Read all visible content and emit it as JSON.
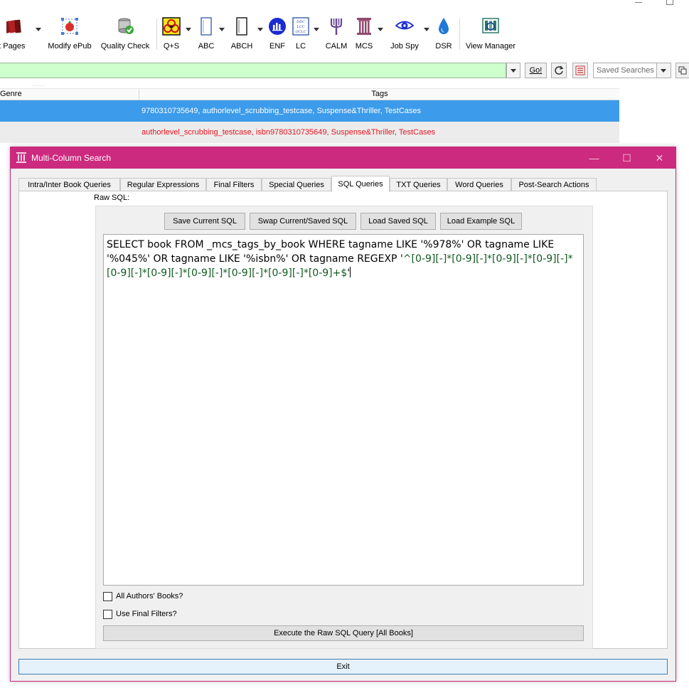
{
  "toolbar": {
    "items": [
      {
        "label": "nt Pages",
        "icon": "books-icon"
      },
      {
        "label": "Modify ePub",
        "icon": "modify-epub-icon"
      },
      {
        "label": "Quality Check",
        "icon": "quality-check-icon"
      },
      {
        "label": "Q+S",
        "icon": "biohazard-icon"
      },
      {
        "label": "ABC",
        "icon": "page-icon"
      },
      {
        "label": "ABCH",
        "icon": "page-dark-icon"
      },
      {
        "label": "ENF",
        "icon": "chart-circle-icon"
      },
      {
        "label": "LC",
        "icon": "ddc-lcc-oclc-icon"
      },
      {
        "label": "CALM",
        "icon": "trident-icon"
      },
      {
        "label": "MCS",
        "icon": "column-icon"
      },
      {
        "label": "Job Spy",
        "icon": "eye-icon"
      },
      {
        "label": "DSR",
        "icon": "water-drop-icon"
      },
      {
        "label": "View Manager",
        "icon": "view-manager-icon"
      }
    ],
    "lc_icon_text": [
      "DDC",
      "LCC",
      "OCLC"
    ]
  },
  "search": {
    "go_label": "Go!",
    "saved_searches_placeholder": "Saved Searches",
    "input_color": "#ccffcc"
  },
  "book_list": {
    "dots": "......",
    "columns": {
      "genre": "Genre",
      "tags": "Tags"
    },
    "rows": [
      {
        "tags": "9780310735649, authorlevel_scrubbing_testcase, Suspense&Thriller, TestCases",
        "selected": true
      },
      {
        "tags": "authorlevel_scrubbing_testcase, isbn9780310735649, Suspense&Thriller, TestCases",
        "selected": false
      }
    ],
    "selected_color": "#3c9bea",
    "row_text_color": "#e8141e"
  },
  "dialog": {
    "title": "Multi-Column Search",
    "title_bar_color": "#cc2a7f",
    "controls": {
      "minimize": "—",
      "maximize": "☐",
      "close": "✕"
    },
    "tabs": [
      {
        "label": "Intra/Inter Book Queries",
        "active": false
      },
      {
        "label": "Regular Expressions",
        "active": false
      },
      {
        "label": "Final Filters",
        "active": false
      },
      {
        "label": "Special Queries",
        "active": false
      },
      {
        "label": "SQL Queries",
        "active": true
      },
      {
        "label": "TXT Queries",
        "active": false
      },
      {
        "label": "Word Queries",
        "active": false
      },
      {
        "label": "Post-Search Actions",
        "active": false
      }
    ],
    "raw_sql_label": "Raw SQL:",
    "sql_buttons": {
      "save_current": "Save Current SQL",
      "swap": "Swap Current/Saved SQL",
      "load_saved": "Load Saved SQL",
      "load_example": "Load Example SQL"
    },
    "sql_text": {
      "plain": "SELECT book FROM _mcs_tags_by_book WHERE tagname LIKE '%978%' OR tagname LIKE '%045%' OR tagname LIKE '%isbn%' OR tagname REGEXP '",
      "regex": "^[0-9][-]*[0-9][-]*[0-9][-]*[0-9][-]*[0-9][-]*[0-9][-]*[0-9][-]*[0-9][-]*[0-9][-]*[0-9]+$",
      "trail": "'"
    },
    "checkboxes": {
      "all_authors": {
        "label": "All Authors' Books?",
        "checked": false
      },
      "use_final_filters": {
        "label": "Use Final Filters?",
        "checked": false
      }
    },
    "execute_label": "Execute the Raw SQL Query [All Books]",
    "exit_label": "Exit"
  }
}
